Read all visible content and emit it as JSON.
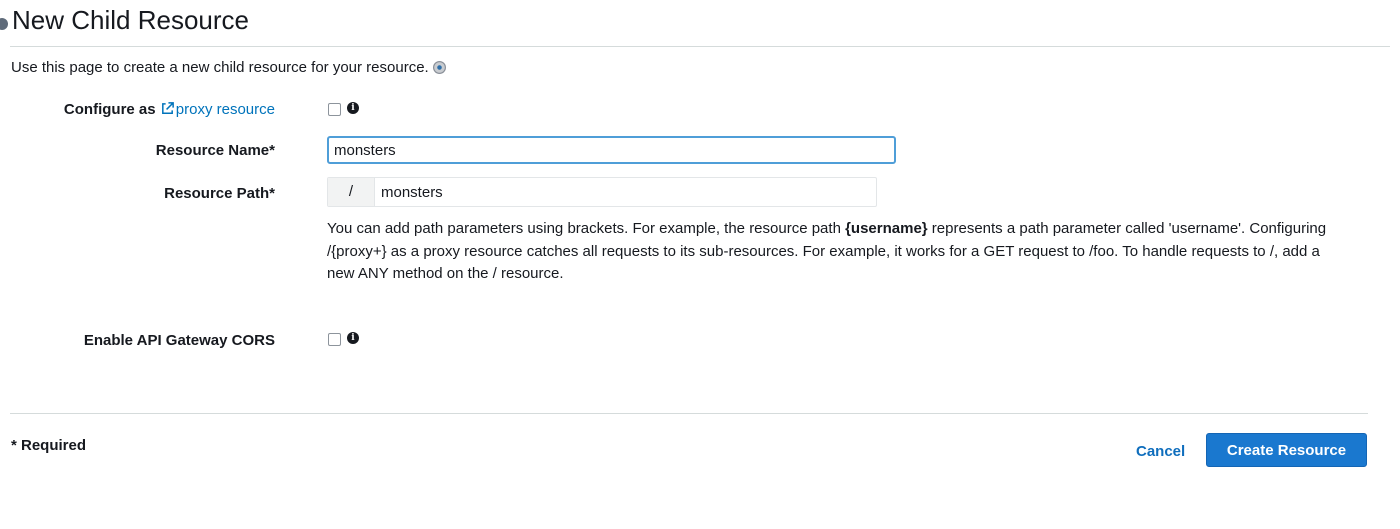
{
  "header": {
    "title": "New Child Resource",
    "intro": "Use this page to create a new child resource for your resource."
  },
  "form": {
    "proxy": {
      "label_prefix": "Configure as",
      "link_text": "proxy resource",
      "checked": false
    },
    "resource_name": {
      "label": "Resource Name*",
      "value": "monsters"
    },
    "resource_path": {
      "label": "Resource Path*",
      "prefix": "/",
      "value": "monsters"
    },
    "help": {
      "part1": "You can add path parameters using brackets. For example, the resource path ",
      "param": "{username}",
      "part2": " represents a path parameter called 'username'. Configuring /{proxy+} as a proxy resource catches all requests to its sub-resources. For example, it works for a GET request to /foo. To handle requests to /, add a new ANY method on the / resource."
    },
    "cors": {
      "label": "Enable API Gateway CORS",
      "checked": false
    }
  },
  "footer": {
    "required_note": "* Required",
    "cancel_label": "Cancel",
    "create_label": "Create Resource"
  },
  "icons": {
    "info": "info-icon",
    "external_link": "external-link-icon"
  },
  "colors": {
    "link": "#0073bb",
    "primary_button": "#1a78cf",
    "input_focus_border": "#4f9ed8"
  }
}
